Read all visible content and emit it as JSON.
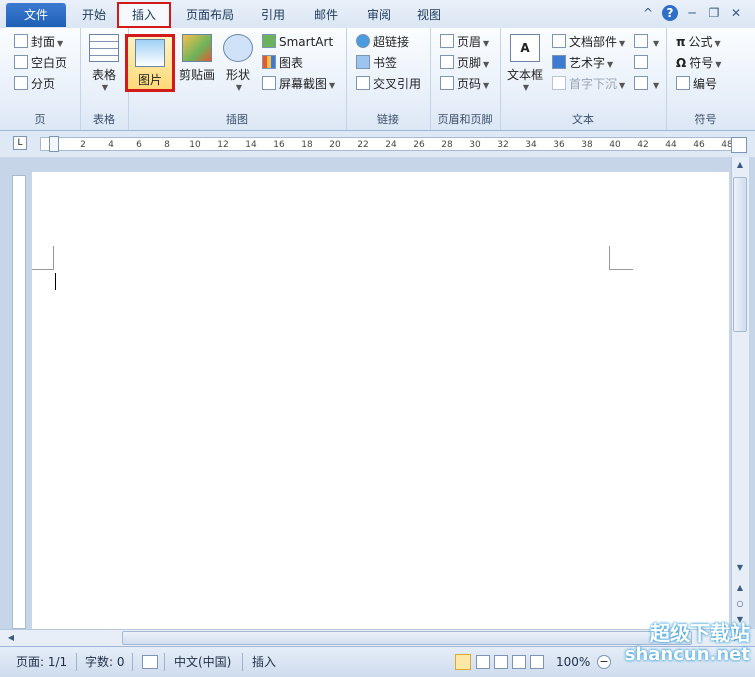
{
  "tabs": {
    "file": "文件",
    "home": "开始",
    "insert": "插入",
    "layout": "页面布局",
    "references": "引用",
    "mailings": "邮件",
    "review": "审阅",
    "view": "视图"
  },
  "window": {
    "help": "?",
    "minimize": "─",
    "restore": "❐",
    "close": "✕",
    "collapse": "^"
  },
  "ribbon": {
    "pages": {
      "cover": "封面",
      "blank": "空白页",
      "break": "分页",
      "label": "页"
    },
    "tables": {
      "table": "表格",
      "label": "表格"
    },
    "illustrations": {
      "picture": "图片",
      "clipart": "剪贴画",
      "shapes": "形状",
      "smartart": "SmartArt",
      "chart": "图表",
      "screenshot": "屏幕截图",
      "label": "插图"
    },
    "links": {
      "hyperlink": "超链接",
      "bookmark": "书签",
      "crossref": "交叉引用",
      "label": "链接"
    },
    "headerfooter": {
      "header": "页眉",
      "footer": "页脚",
      "pagenum": "页码",
      "label": "页眉和页脚"
    },
    "text": {
      "textbox": "文本框",
      "quickparts": "文档部件",
      "wordart": "艺术字",
      "dropcap": "首字下沉",
      "label": "文本"
    },
    "symbols": {
      "equation": "公式",
      "symbol": "符号",
      "number": "编号",
      "label": "符号"
    }
  },
  "ruler": {
    "marks": [
      "2",
      "4",
      "6",
      "8",
      "10",
      "12",
      "14",
      "16",
      "18",
      "20",
      "22",
      "24",
      "26",
      "28",
      "30",
      "32",
      "34",
      "36",
      "38",
      "40",
      "42",
      "44",
      "46",
      "48"
    ]
  },
  "status": {
    "page": "页面: 1/1",
    "words": "字数: 0",
    "language": "中文(中国)",
    "mode": "插入",
    "zoom": "100%"
  },
  "watermark": {
    "line1": "超级下载站",
    "line2": "shancun.net"
  },
  "colors": {
    "accent": "#2b6cc4",
    "highlight": "#d21a1a",
    "ribbon_bg": "#e7eff9"
  }
}
